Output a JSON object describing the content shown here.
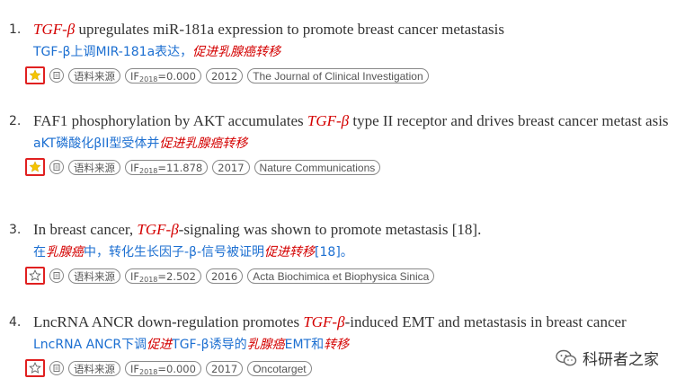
{
  "results": [
    {
      "number": "1.",
      "title": [
        {
          "text": "TGF-β",
          "hl": true
        },
        {
          "text": " upregulates miR-181a expression to promote breast cancer metastasis",
          "hl": false
        }
      ],
      "subtitle": [
        {
          "text": "TGF-β上调MIR-181a表达，",
          "hl": false
        },
        {
          "text": "促进乳腺癌转移",
          "hl": true
        }
      ],
      "star_filled": true,
      "source_tag": "语料来源",
      "if_label": "IF",
      "if_year": "2018",
      "if_value": "=0.000",
      "year": "2012",
      "journal": "The Journal of Clinical Investigation"
    },
    {
      "number": "2.",
      "title": [
        {
          "text": "FAF1 phosphorylation by AKT accumulates ",
          "hl": false
        },
        {
          "text": "TGF-β",
          "hl": true
        },
        {
          "text": " type II receptor and drives breast cancer metast asis",
          "hl": false
        }
      ],
      "subtitle": [
        {
          "text": "aKT磷酸化βII型受体并",
          "hl": false
        },
        {
          "text": "促进乳腺癌转移",
          "hl": true
        }
      ],
      "star_filled": true,
      "source_tag": "语料来源",
      "if_label": "IF",
      "if_year": "2018",
      "if_value": "=11.878",
      "year": "2017",
      "journal": "Nature Communications"
    },
    {
      "number": "3.",
      "title": [
        {
          "text": "In breast cancer, ",
          "hl": false
        },
        {
          "text": "TGF-β",
          "hl": true
        },
        {
          "text": "-signaling was shown to promote metastasis [18].",
          "hl": false
        }
      ],
      "subtitle": [
        {
          "text": "在",
          "hl": false
        },
        {
          "text": "乳腺癌",
          "hl": true
        },
        {
          "text": "中，转化生长因子-β-信号被证明",
          "hl": false
        },
        {
          "text": "促进转移",
          "hl": true
        },
        {
          "text": "[18]。",
          "hl": false
        }
      ],
      "star_filled": false,
      "source_tag": "语料来源",
      "if_label": "IF",
      "if_year": "2018",
      "if_value": "=2.502",
      "year": "2016",
      "journal": "Acta Biochimica et Biophysica Sinica"
    },
    {
      "number": "4.",
      "title": [
        {
          "text": "LncRNA ANCR down-regulation promotes ",
          "hl": false
        },
        {
          "text": "TGF-β",
          "hl": true
        },
        {
          "text": "-induced EMT and metastasis in breast cancer",
          "hl": false
        }
      ],
      "subtitle": [
        {
          "text": "LncRNA ANCR下调",
          "hl": false
        },
        {
          "text": "促进",
          "hl": true
        },
        {
          "text": "TGF-β诱导的",
          "hl": false
        },
        {
          "text": "乳腺癌",
          "hl": true
        },
        {
          "text": "EMT和",
          "hl": false
        },
        {
          "text": "转移",
          "hl": true
        }
      ],
      "star_filled": false,
      "source_tag": "语料来源",
      "if_label": "IF",
      "if_year": "2018",
      "if_value": "=0.000",
      "year": "2017",
      "journal": "Oncotarget"
    }
  ],
  "watermark": {
    "text": "科研者之家",
    "icon": "wechat-icon"
  },
  "colors": {
    "highlight": "#d40000",
    "link_blue": "#1c6fd1",
    "star_gold": "#f5c400",
    "frame_red": "#e02020"
  }
}
